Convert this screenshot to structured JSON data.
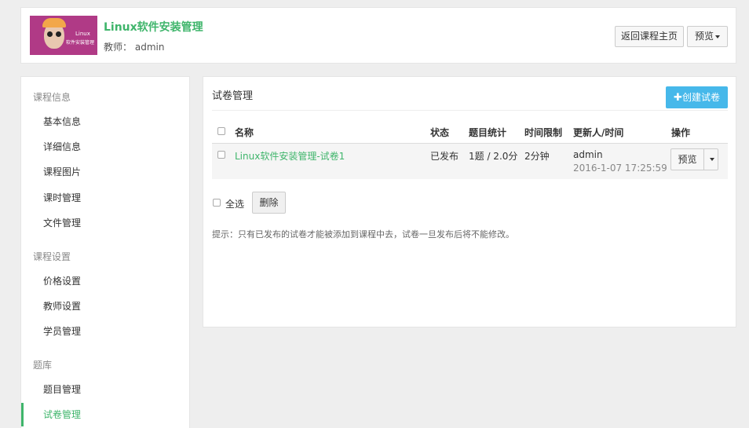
{
  "header": {
    "thumb_line1": "Linux",
    "thumb_line2": "软件安装管理",
    "course_title": "Linux软件安装管理",
    "teacher_label": "教师：",
    "teacher_name": "admin",
    "back_button": "返回课程主页",
    "preview_button": "预览"
  },
  "sidebar": {
    "groups": [
      {
        "title": "课程信息",
        "items": [
          "基本信息",
          "详细信息",
          "课程图片",
          "课时管理",
          "文件管理"
        ]
      },
      {
        "title": "课程设置",
        "items": [
          "价格设置",
          "教师设置",
          "学员管理"
        ]
      },
      {
        "title": "题库",
        "items": [
          "题目管理",
          "试卷管理"
        ]
      }
    ],
    "active_item": "试卷管理"
  },
  "main": {
    "title": "试卷管理",
    "create_button": "创建试卷",
    "table": {
      "headers": [
        "名称",
        "状态",
        "题目统计",
        "时间限制",
        "更新人/时间",
        "操作"
      ],
      "rows": [
        {
          "name": "Linux软件安装管理-试卷1",
          "status": "已发布",
          "stats": "1题 / 2.0分",
          "time_limit": "2分钟",
          "updater": "admin",
          "updated_at": "2016-1-07 17:25:59",
          "action": "预览"
        }
      ]
    },
    "select_all": "全选",
    "delete_button": "删除",
    "tip": "提示：只有已发布的试卷才能被添加到课程中去，试卷一旦发布后将不能修改。"
  },
  "colors": {
    "accent": "#3fb56b",
    "primary_button": "#46b8ea",
    "background": "#eeeeee"
  }
}
